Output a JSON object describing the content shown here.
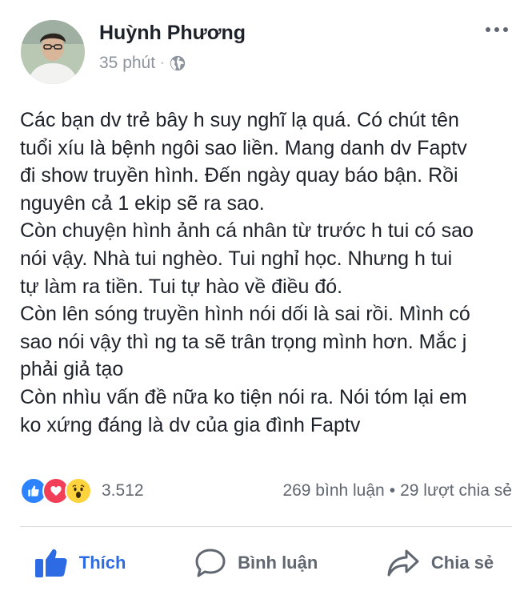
{
  "post": {
    "author": "Huỳnh Phương",
    "time": "35 phút",
    "separator": "·",
    "privacy_icon": "globe-icon",
    "menu_icon": "more-options-icon",
    "text_lines": [
      "Các bạn dv trẻ bây h suy nghĩ lạ quá. Có chút tên",
      "tuổi xíu là bệnh ngôi sao liền. Mang danh dv Faptv",
      "đi show truyền hình. Đến ngày quay báo bận.  Rồi",
      "nguyên cả 1 ekip sẽ ra sao.",
      "Còn chuyện hình ảnh cá nhân từ trước h tui có sao",
      "nói vậy. Nhà tui nghèo. Tui nghỉ học. Nhưng h tui",
      "tự làm ra tiền. Tui tự hào về điều đó.",
      "Còn lên sóng truyền hình nói dối là sai rồi. Mình có",
      "sao nói vậy thì ng ta sẽ trân trọng mình hơn. Mắc j",
      "phải giả tạo",
      "Còn nhìu vấn đề nữa ko tiện nói ra. Nói tóm lại em",
      "ko xứng đáng là dv của gia đình Faptv"
    ]
  },
  "stats": {
    "reaction_icons": [
      "like-reaction-icon",
      "love-reaction-icon",
      "wow-reaction-icon"
    ],
    "reaction_count": "3.512",
    "comments": "269 bình luận",
    "separator": "•",
    "shares": "29 lượt chia sẻ"
  },
  "actions": {
    "like_label": "Thích",
    "comment_label": "Bình luận",
    "share_label": "Chia sẻ"
  },
  "colors": {
    "accent": "#2d6be4",
    "like": "#2c82ff",
    "love": "#f33e58",
    "wow": "#fdd43e",
    "muted": "#606770"
  }
}
